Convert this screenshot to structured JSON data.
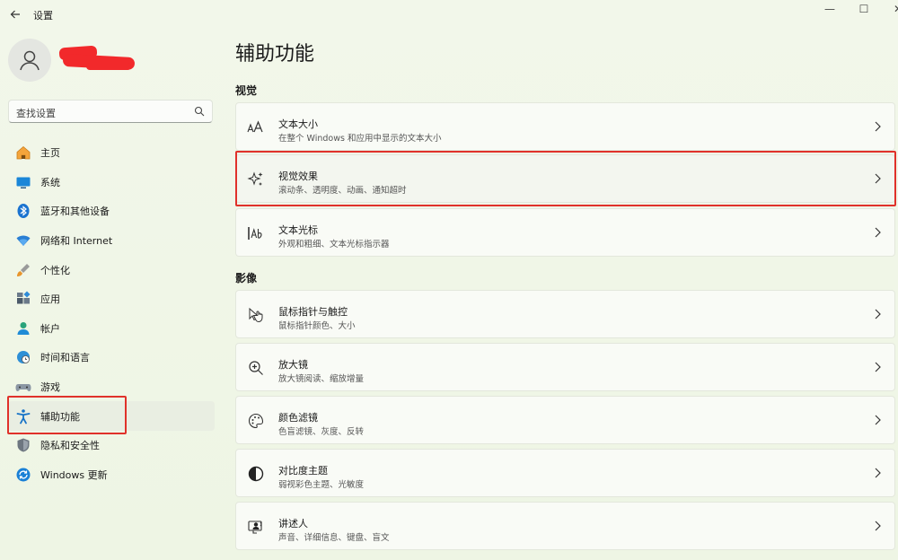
{
  "window": {
    "title": "设置",
    "controls": {
      "minimize": "—",
      "maximize": "☐",
      "close": "✕"
    }
  },
  "search": {
    "placeholder": "查找设置"
  },
  "sidebar": {
    "items": [
      {
        "label": "主页",
        "icon": "home-icon"
      },
      {
        "label": "系统",
        "icon": "monitor-icon"
      },
      {
        "label": "蓝牙和其他设备",
        "icon": "bluetooth-icon"
      },
      {
        "label": "网络和 Internet",
        "icon": "wifi-icon"
      },
      {
        "label": "个性化",
        "icon": "brush-icon"
      },
      {
        "label": "应用",
        "icon": "apps-icon"
      },
      {
        "label": "帐户",
        "icon": "person-icon"
      },
      {
        "label": "时间和语言",
        "icon": "globe-clock-icon"
      },
      {
        "label": "游戏",
        "icon": "gamepad-icon"
      },
      {
        "label": "辅助功能",
        "icon": "accessibility-icon",
        "selected": true
      },
      {
        "label": "隐私和安全性",
        "icon": "shield-icon"
      },
      {
        "label": "Windows 更新",
        "icon": "update-icon"
      }
    ]
  },
  "main": {
    "title": "辅助功能",
    "sections": {
      "vision": "视觉",
      "hearing": "影像"
    },
    "cards": [
      {
        "title": "文本大小",
        "subtitle": "在整个 Windows 和应用中显示的文本大小",
        "icon": "text-size-icon"
      },
      {
        "title": "视觉效果",
        "subtitle": "滚动条、透明度、动画、通知超时",
        "icon": "sparkle-icon"
      },
      {
        "title": "文本光标",
        "subtitle": "外观和粗细、文本光标指示器",
        "icon": "text-cursor-icon"
      },
      {
        "title": "鼠标指针与触控",
        "subtitle": "鼠标指针颜色、大小",
        "icon": "pointer-icon"
      },
      {
        "title": "放大镜",
        "subtitle": "放大镜阅读、缩放增量",
        "icon": "magnifier-icon"
      },
      {
        "title": "颜色滤镜",
        "subtitle": "色盲滤镜、灰度、反转",
        "icon": "palette-icon"
      },
      {
        "title": "对比度主题",
        "subtitle": "弱视彩色主题、光敏度",
        "icon": "contrast-icon"
      },
      {
        "title": "讲述人",
        "subtitle": "声音、详细信息、键盘、盲文",
        "icon": "narrator-icon"
      }
    ]
  },
  "colors": {
    "highlight": "#e0312a",
    "accent": "#0067c0"
  }
}
